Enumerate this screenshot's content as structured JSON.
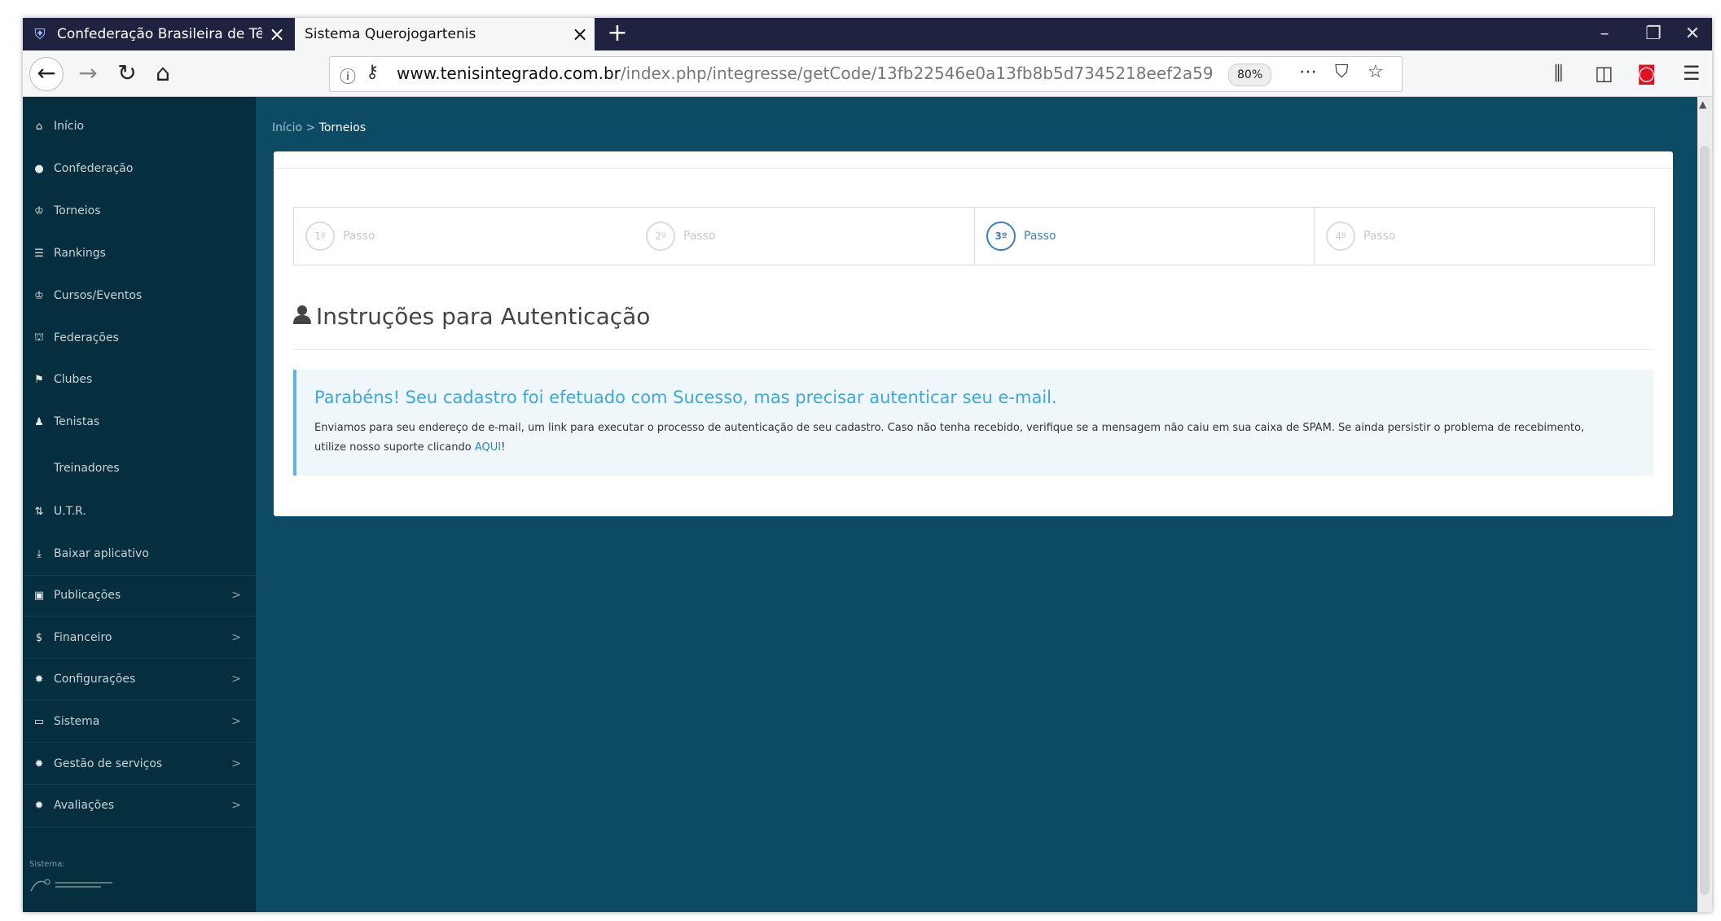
{
  "browser": {
    "tabs": [
      {
        "title": "Confederação Brasileira de Tênis",
        "active": false
      },
      {
        "title": "Sistema Querojogartenis",
        "active": true
      }
    ],
    "new_tab": "+",
    "url_domain": "www.tenisintegrado.com.br",
    "url_path": "/index.php/integresse/getCode/13fb22546e0a13fb8b5d7345218eef2a59",
    "zoom": "80%",
    "icons": [
      "back-icon",
      "forward-icon",
      "reload-icon",
      "home-icon",
      "info-icon",
      "key-icon",
      "page-actions-icon",
      "pocket-icon",
      "bookmark-star-icon",
      "library-icon",
      "sidebar-icon",
      "extension-icon",
      "menu-icon"
    ]
  },
  "sidebar": {
    "items": [
      {
        "label": "Início",
        "icon": "home-icon"
      },
      {
        "label": "Confederação",
        "icon": "globe-icon"
      },
      {
        "label": "Torneios",
        "icon": "trophy-icon"
      },
      {
        "label": "Rankings",
        "icon": "list-icon"
      },
      {
        "label": "Cursos/Eventos",
        "icon": "trophy-icon"
      },
      {
        "label": "Federações",
        "icon": "institution-icon"
      },
      {
        "label": "Clubes",
        "icon": "flag-icon"
      },
      {
        "label": "Tenistas",
        "icon": "users-icon"
      },
      {
        "label": "Treinadores",
        "icon": ""
      },
      {
        "label": "U.T.R.",
        "icon": "sort-numeric-icon"
      },
      {
        "label": "Baixar aplicativo",
        "icon": "download-icon"
      },
      {
        "label": "Publicações",
        "icon": "newspaper-icon"
      },
      {
        "label": "Financeiro",
        "icon": "dollar-icon"
      },
      {
        "label": "Configurações",
        "icon": "gear-icon"
      },
      {
        "label": "Sistema",
        "icon": "laptop-icon"
      },
      {
        "label": "Gestão de serviços",
        "icon": "gear-icon"
      },
      {
        "label": "Avaliações",
        "icon": "gear-icon"
      }
    ],
    "chevron": ">",
    "footer_label": "Sistema:"
  },
  "breadcrumb": {
    "home": "Início",
    "separator": ">",
    "current": "Torneios"
  },
  "wizard": {
    "steps": [
      {
        "number": "1º",
        "label": "Passo"
      },
      {
        "number": "2º",
        "label": "Passo"
      },
      {
        "number": "3º",
        "label": "Passo"
      },
      {
        "number": "4º",
        "label": "Passo"
      }
    ],
    "active_step": 3
  },
  "auth": {
    "title": "Instruções para Autenticação",
    "alert_title": "Parabéns! Seu cadastro foi efetuado com Sucesso, mas precisar autenticar seu e-mail.",
    "alert_body": "Enviamos para seu endereço de e-mail, um link para executar o processo de autenticação de seu cadastro. Caso não tenha recebido, verifique se a mensagem não caiu em sua caixa de SPAM. Se ainda persistir o problema de recebimento, utilize nosso suporte clicando ",
    "alert_link": "AQUI",
    "alert_end": "!"
  },
  "colors": {
    "tabstrip": "#202340",
    "sidebar": "#052f3e",
    "content": "#0d4a63",
    "alert_accent": "#5bb6e2",
    "active_step": "#3b7fbf"
  }
}
